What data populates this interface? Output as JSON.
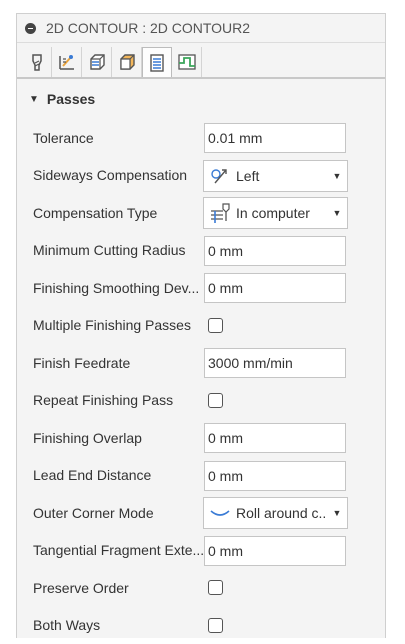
{
  "panel": {
    "title": "2D CONTOUR : 2D CONTOUR2",
    "tabs": [
      {
        "icon": "tool-icon",
        "active": false
      },
      {
        "icon": "geometry-icon",
        "active": false
      },
      {
        "icon": "heights-icon",
        "active": false
      },
      {
        "icon": "stock-icon",
        "active": false
      },
      {
        "icon": "passes-icon",
        "active": true
      },
      {
        "icon": "linking-icon",
        "active": false
      }
    ],
    "section": "Passes",
    "rows": {
      "tolerance": {
        "label": "Tolerance",
        "value": "0.01 mm"
      },
      "sideways": {
        "label": "Sideways Compensation",
        "value": "Left",
        "icon": "sideways-compensation-icon"
      },
      "comp_type": {
        "label": "Compensation Type",
        "value": "In computer",
        "icon": "compensation-type-icon"
      },
      "min_radius": {
        "label": "Minimum Cutting Radius",
        "value": "0 mm"
      },
      "smoothing": {
        "label": "Finishing Smoothing Dev...",
        "value": "0 mm"
      },
      "multi_finish": {
        "label": "Multiple Finishing Passes",
        "checked": false
      },
      "feedrate": {
        "label": "Finish Feedrate",
        "value": "3000 mm/min"
      },
      "repeat_finish": {
        "label": "Repeat Finishing Pass",
        "checked": false
      },
      "overlap": {
        "label": "Finishing Overlap",
        "value": "0 mm"
      },
      "lead_end": {
        "label": "Lead End Distance",
        "value": "0 mm"
      },
      "outer_corner": {
        "label": "Outer Corner Mode",
        "value": "Roll around c...",
        "icon": "roll-around-icon"
      },
      "tangential": {
        "label": "Tangential Fragment Exte...",
        "value": "0 mm"
      },
      "preserve_order": {
        "label": "Preserve Order",
        "checked": false
      },
      "both_ways": {
        "label": "Both Ways",
        "checked": false
      }
    }
  }
}
